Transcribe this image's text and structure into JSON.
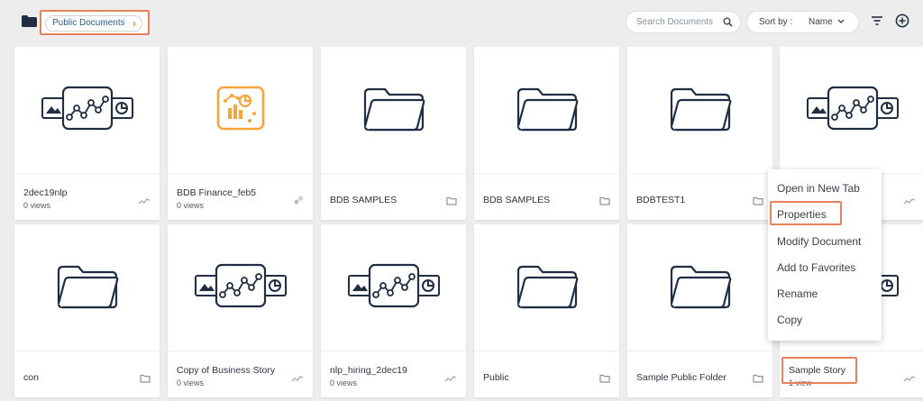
{
  "toolbar": {
    "breadcrumb": "Public Documents",
    "search_placeholder": "Search Documents",
    "sort_label": "Sort by :",
    "sort_value": "Name"
  },
  "icons": {
    "folder": "folder-icon",
    "story": "story-icon",
    "dashboard": "dashboard-icon",
    "trend": "trend-icon",
    "search": "search-icon",
    "filter": "filter-icon",
    "add": "add-icon"
  },
  "colors": {
    "accent": "#e8825a",
    "orange": "#f7a43a",
    "icon_navy": "#1f2e44"
  },
  "documents": [
    {
      "name": "2dec19nlp",
      "views": "0 views",
      "type": "story"
    },
    {
      "name": "BDB Finance_feb5",
      "views": "0 views",
      "type": "dashboard"
    },
    {
      "name": "BDB SAMPLES",
      "views": "",
      "type": "folder"
    },
    {
      "name": "BDB SAMPLES",
      "views": "",
      "type": "folder"
    },
    {
      "name": "BDBTEST1",
      "views": "",
      "type": "folder"
    },
    {
      "name": "",
      "views": "",
      "type": "story"
    },
    {
      "name": "con",
      "views": "",
      "type": "folder"
    },
    {
      "name": "Copy of Business Story",
      "views": "0 views",
      "type": "story"
    },
    {
      "name": "nlp_hiring_2dec19",
      "views": "0 views",
      "type": "story"
    },
    {
      "name": "Public",
      "views": "",
      "type": "folder"
    },
    {
      "name": "Sample Public Folder",
      "views": "",
      "type": "folder"
    },
    {
      "name": "Sample Story",
      "views": "1 view",
      "type": "story"
    }
  ],
  "context_menu": {
    "items": [
      "Open in New Tab",
      "Properties",
      "Modify Document",
      "Add to Favorites",
      "Rename",
      "Copy"
    ]
  }
}
